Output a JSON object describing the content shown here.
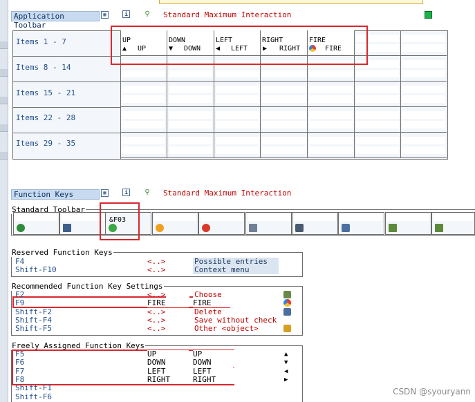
{
  "top_partial_text": "Standard Maximum Interaction",
  "app_toolbar": {
    "label": "Application Toolbar",
    "status_text": "Standard Maximum Interaction",
    "status_color": "#19b34a"
  },
  "items_rows": [
    "Items  1 - 7",
    "Items  8 - 14",
    "Items 15 - 21",
    "Items 22 - 28",
    "Items 29 - 35"
  ],
  "items_first_row": [
    {
      "name": "UP",
      "icon": "▲",
      "value": "UP"
    },
    {
      "name": "DOWN",
      "icon": "▼",
      "value": "DOWN"
    },
    {
      "name": "LEFT",
      "icon": "◀",
      "value": "LEFT"
    },
    {
      "name": "RIGHT",
      "icon": "▶",
      "value": "RIGHT"
    },
    {
      "name": "FIRE",
      "icon": "fire-icon",
      "value": "FIRE"
    }
  ],
  "function_keys": {
    "label": "Function Keys",
    "status_text": "Standard Maximum Interaction"
  },
  "standard_toolbar": {
    "title": "Standard Toolbar",
    "back_code": "&F03",
    "icons": [
      "check-icon",
      "save-icon",
      "back-icon",
      "exit-icon",
      "cancel-icon",
      "print-icon",
      "find-icon",
      "find-next-icon",
      "first-page-icon",
      "previous-page-icon"
    ]
  },
  "reserved": {
    "title": "Reserved Function Keys",
    "rows": [
      {
        "key": "F4",
        "code": "<..>",
        "desc": "Possible entries"
      },
      {
        "key": "Shift-F10",
        "code": "<..>",
        "desc": "Context menu"
      }
    ]
  },
  "recommended": {
    "title": "Recommended Function Key Settings",
    "rows": [
      {
        "key": "F2",
        "code": "<..>",
        "desc": "Choose",
        "icon": "choose-icon"
      },
      {
        "key": "F9",
        "code": "FIRE",
        "desc": "FIRE",
        "icon": "fire-icon"
      },
      {
        "key": "Shift-F2",
        "code": "<..>",
        "desc": "Delete",
        "icon": "delete-icon"
      },
      {
        "key": "Shift-F4",
        "code": "<..>",
        "desc": "Save without check",
        "icon": ""
      },
      {
        "key": "Shift-F5",
        "code": "<..>",
        "desc": "Other <object>",
        "icon": "other-object-icon"
      }
    ]
  },
  "freely": {
    "title": "Freely Assigned Function Keys",
    "rows": [
      {
        "key": "F5",
        "code": "UP",
        "desc": "UP",
        "icon": "▲"
      },
      {
        "key": "F6",
        "code": "DOWN",
        "desc": "DOWN",
        "icon": "▼"
      },
      {
        "key": "F7",
        "code": "LEFT",
        "desc": "LEFT",
        "icon": "◀"
      },
      {
        "key": "F8",
        "code": "RIGHT",
        "desc": "RIGHT",
        "icon": "▶"
      },
      {
        "key": "Shift-F1",
        "code": "",
        "desc": "",
        "icon": ""
      },
      {
        "key": "Shift-F6",
        "code": "",
        "desc": "",
        "icon": ""
      }
    ]
  },
  "watermark": "CSDN @syouryann"
}
